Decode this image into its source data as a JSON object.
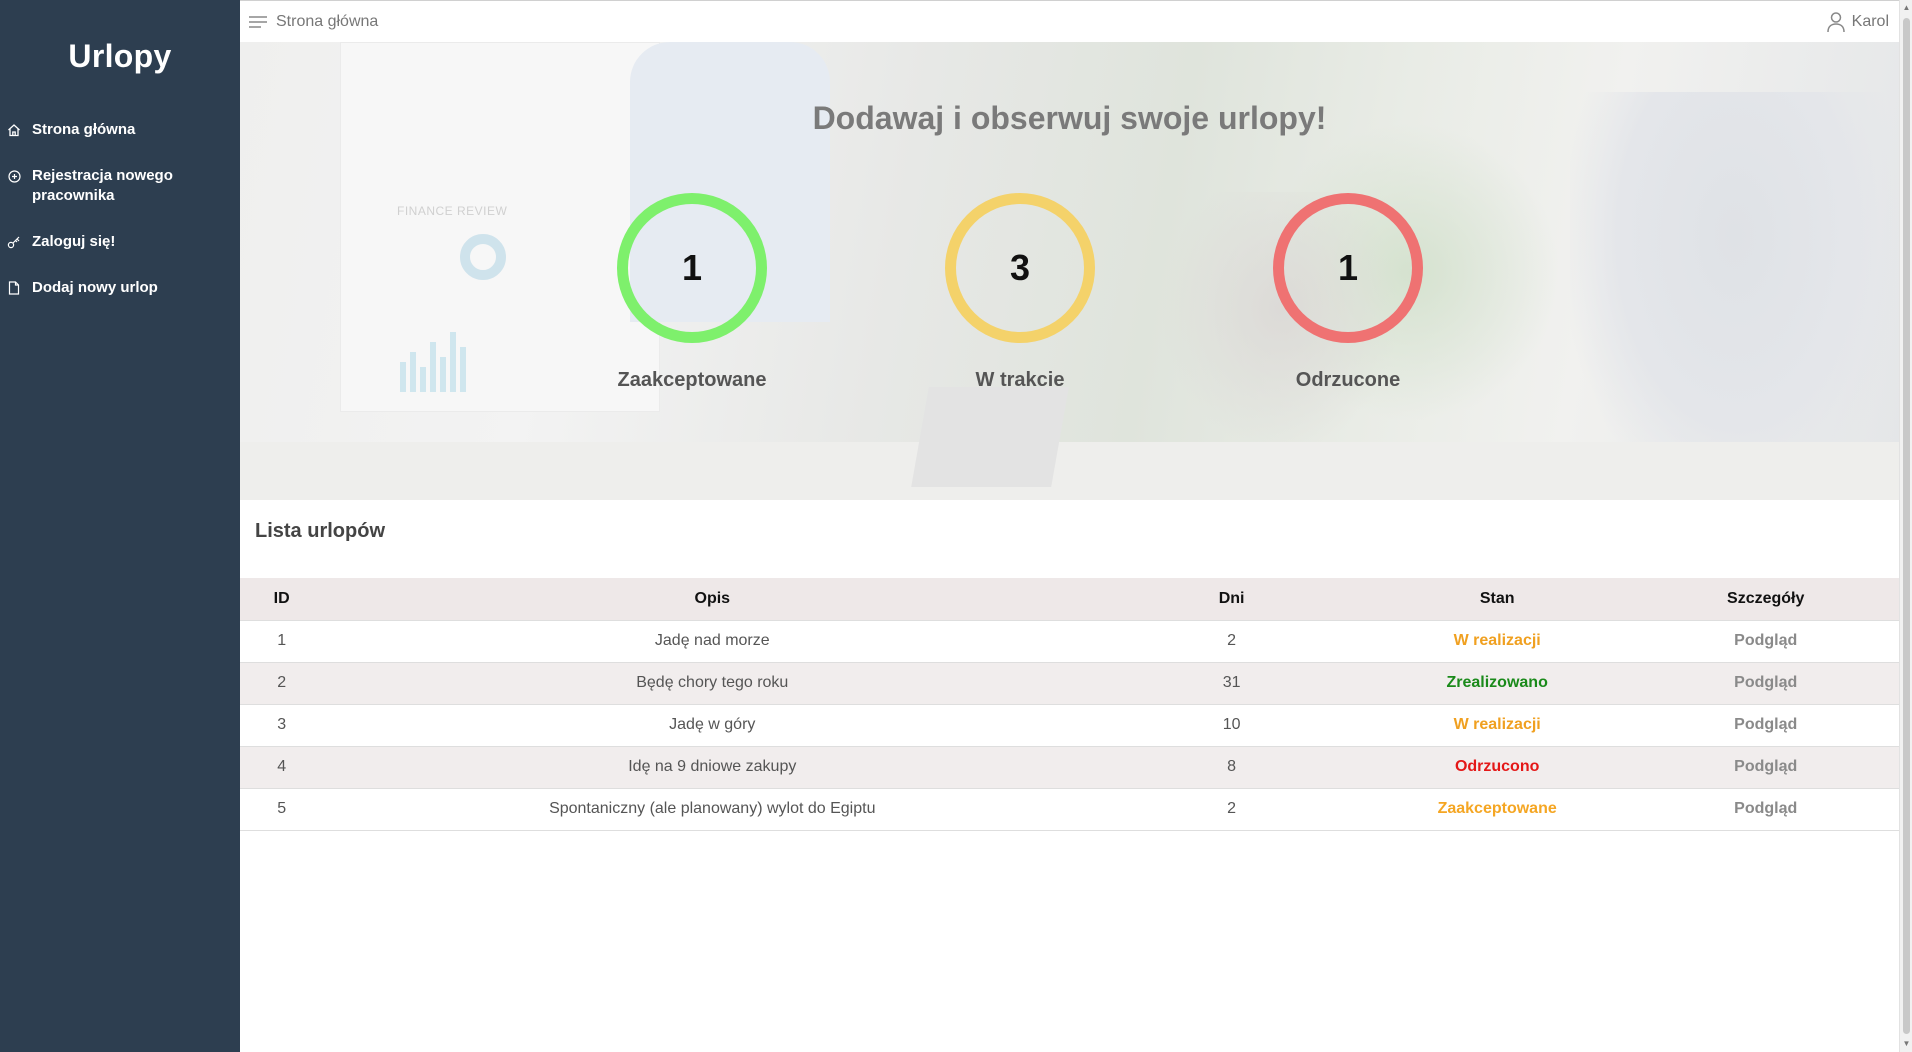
{
  "sidebar": {
    "brand": "Urlopy",
    "items": [
      {
        "label": "Strona główna",
        "icon": "home-icon"
      },
      {
        "label": "Rejestracja nowego pracownika",
        "icon": "plus-circle-icon"
      },
      {
        "label": "Zaloguj się!",
        "icon": "key-icon"
      },
      {
        "label": "Dodaj nowy urlop",
        "icon": "document-icon"
      }
    ]
  },
  "topbar": {
    "breadcrumb": "Strona główna",
    "user": "Karol",
    "menu_icon": "menu-icon",
    "user_icon": "user-icon"
  },
  "hero": {
    "title": "Dodawaj i obserwuj swoje urlopy!",
    "background_caption": "FINANCE REVIEW",
    "stats": [
      {
        "value": "1",
        "label": "Zaakceptowane",
        "color": "#7ef06c"
      },
      {
        "value": "3",
        "label": "W trakcie",
        "color": "#f4d26a"
      },
      {
        "value": "1",
        "label": "Odrzucone",
        "color": "#ef7272"
      }
    ]
  },
  "list": {
    "title": "Lista urlopów",
    "columns": [
      "ID",
      "Opis",
      "Dni",
      "Stan",
      "Szczegóły"
    ],
    "rows": [
      {
        "id": "1",
        "opis": "Jadę nad morze",
        "dni": "2",
        "stan": "W realizacji",
        "stan_color": "#f0a020",
        "szczegoly": "Podgląd"
      },
      {
        "id": "2",
        "opis": "Będę chory tego roku",
        "dni": "31",
        "stan": "Zrealizowano",
        "stan_color": "#1a8a1a",
        "szczegoly": "Podgląd"
      },
      {
        "id": "3",
        "opis": "Jadę w góry",
        "dni": "10",
        "stan": "W realizacji",
        "stan_color": "#f0a020",
        "szczegoly": "Podgląd"
      },
      {
        "id": "4",
        "opis": "Idę na 9 dniowe zakupy",
        "dni": "8",
        "stan": "Odrzucono",
        "stan_color": "#e41818",
        "szczegoly": "Podgląd"
      },
      {
        "id": "5",
        "opis": "Spontaniczny (ale planowany) wylot do Egiptu",
        "dni": "2",
        "stan": "Zaakceptowane",
        "stan_color": "#f5a623",
        "szczegoly": "Podgląd"
      }
    ]
  }
}
